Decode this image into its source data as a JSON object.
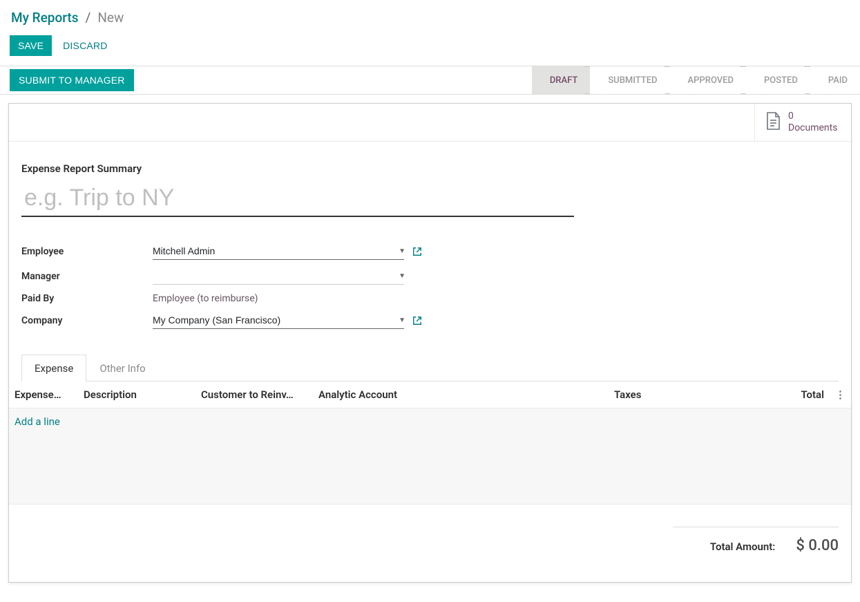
{
  "breadcrumb": {
    "root": "My Reports",
    "separator": "/",
    "current": "New"
  },
  "actions": {
    "save": "SAVE",
    "discard": "DISCARD"
  },
  "statusbar": {
    "submit": "SUBMIT TO MANAGER",
    "stages": [
      "DRAFT",
      "SUBMITTED",
      "APPROVED",
      "POSTED",
      "PAID"
    ],
    "active_index": 0
  },
  "stat_button": {
    "count": "0",
    "label": "Documents"
  },
  "form": {
    "summary_label": "Expense Report Summary",
    "title_placeholder": "e.g. Trip to NY",
    "fields": {
      "employee": {
        "label": "Employee",
        "value": "Mitchell Admin"
      },
      "manager": {
        "label": "Manager",
        "value": ""
      },
      "paid_by": {
        "label": "Paid By",
        "value": "Employee (to reimburse)"
      },
      "company": {
        "label": "Company",
        "value": "My Company (San Francisco)"
      }
    }
  },
  "tabs": {
    "items": [
      "Expense",
      "Other Info"
    ],
    "active_index": 0
  },
  "table": {
    "headers": {
      "expense_date": "Expense…",
      "description": "Description",
      "customer": "Customer to Reinv…",
      "analytic": "Analytic Account",
      "taxes": "Taxes",
      "total": "Total"
    },
    "add_line": "Add a line"
  },
  "totals": {
    "label": "Total Amount:",
    "currency": "$",
    "value": "0.00"
  }
}
